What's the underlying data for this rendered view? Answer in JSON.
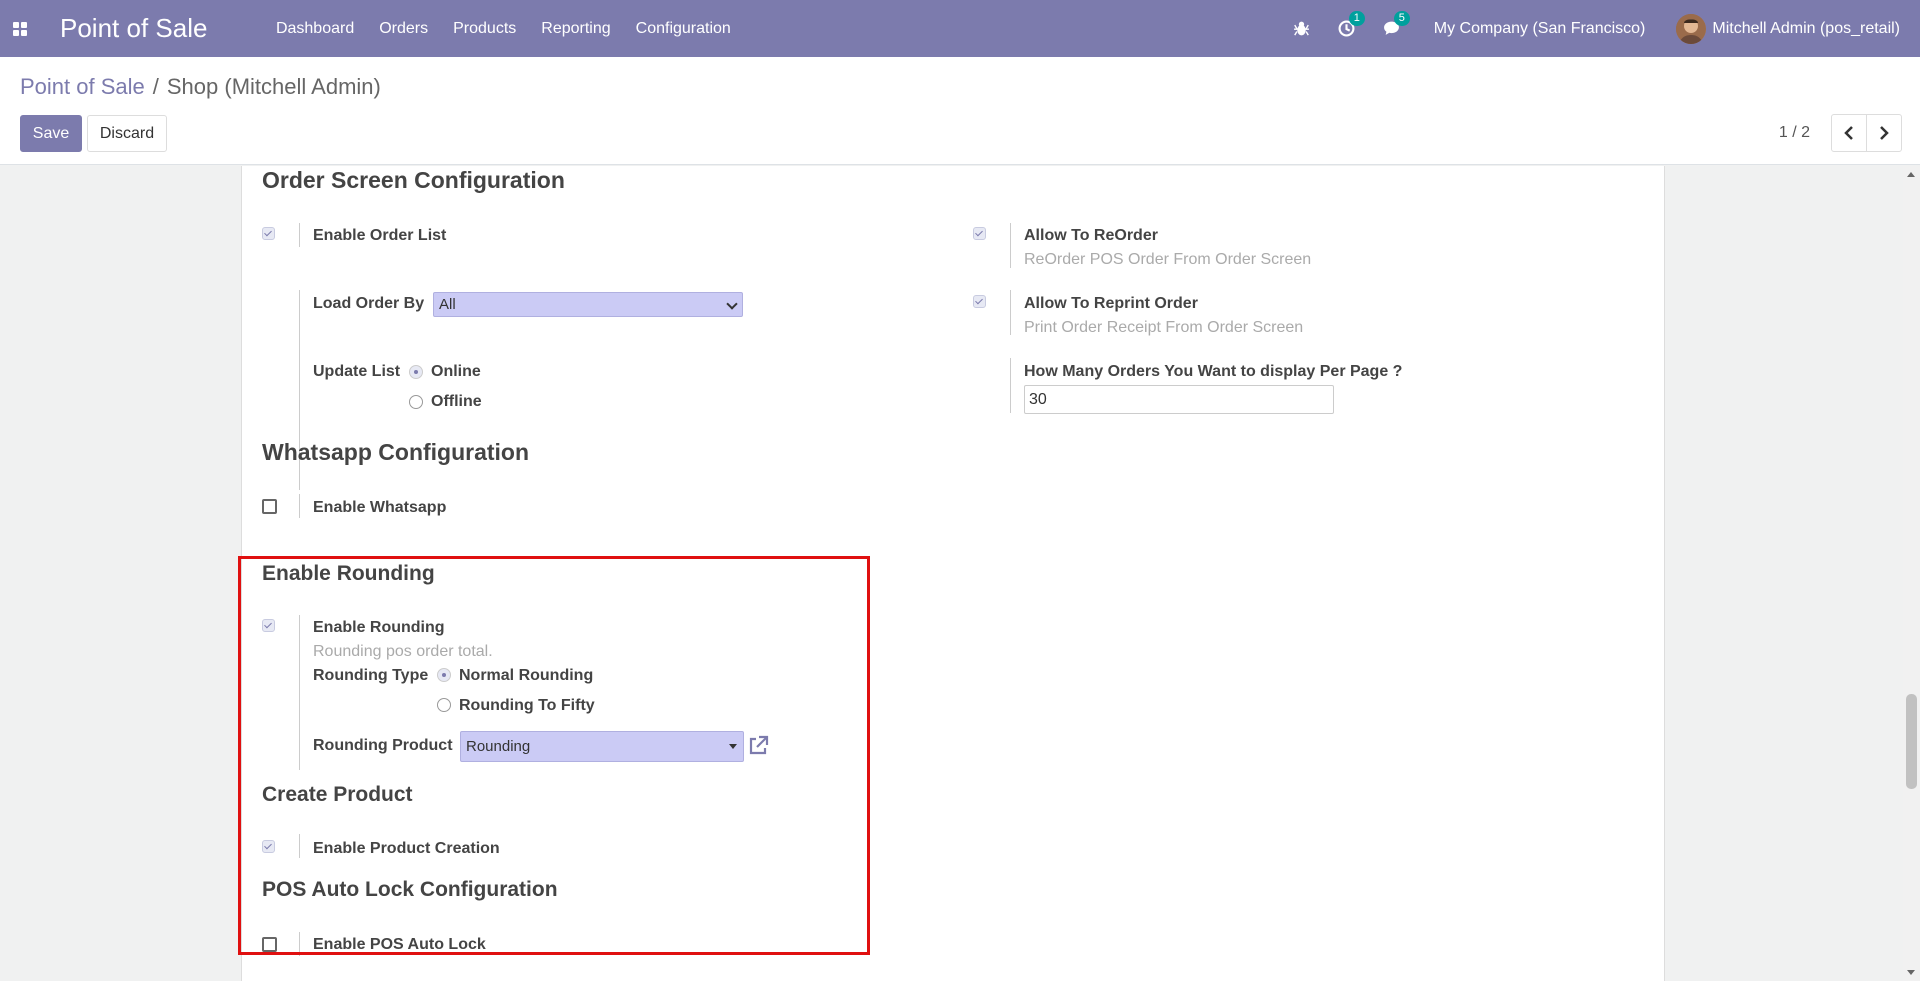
{
  "navbar": {
    "app_name": "Point of Sale",
    "menu": [
      "Dashboard",
      "Orders",
      "Products",
      "Reporting",
      "Configuration"
    ],
    "activity_count": "1",
    "messages_count": "5",
    "company": "My Company (San Francisco)",
    "user": "Mitchell Admin (pos_retail)"
  },
  "breadcrumb": {
    "parent": "Point of Sale",
    "separator": "/",
    "current": "Shop (Mitchell Admin)"
  },
  "buttons": {
    "save": "Save",
    "discard": "Discard"
  },
  "pager": {
    "value": "1 / 2"
  },
  "order_screen": {
    "title": "Order Screen Configuration",
    "enable_order_list": "Enable Order List",
    "load_order_by_label": "Load Order By",
    "load_order_by_value": "All",
    "update_list_label": "Update List",
    "update_list_online": "Online",
    "update_list_offline": "Offline",
    "allow_reorder": "Allow To ReOrder",
    "allow_reorder_help": "ReOrder POS Order From Order Screen",
    "allow_reprint": "Allow To Reprint Order",
    "allow_reprint_help": "Print Order Receipt From Order Screen",
    "per_page_label": "How Many Orders You Want to display Per Page ?",
    "per_page_value": "30"
  },
  "whatsapp": {
    "title": "Whatsapp Configuration",
    "enable": "Enable Whatsapp"
  },
  "rounding": {
    "title": "Enable Rounding",
    "enable": "Enable Rounding",
    "help": "Rounding pos order total.",
    "type_label": "Rounding Type",
    "type_normal": "Normal Rounding",
    "type_fifty": "Rounding To Fifty",
    "product_label": "Rounding Product",
    "product_value": "Rounding"
  },
  "create_product": {
    "title": "Create Product",
    "enable": "Enable Product Creation"
  },
  "auto_lock": {
    "title": "POS Auto Lock Configuration",
    "enable": "Enable POS Auto Lock"
  },
  "colors": {
    "brand": "#7c7bad",
    "highlight": "#e01010",
    "badge": "#00a09d"
  }
}
